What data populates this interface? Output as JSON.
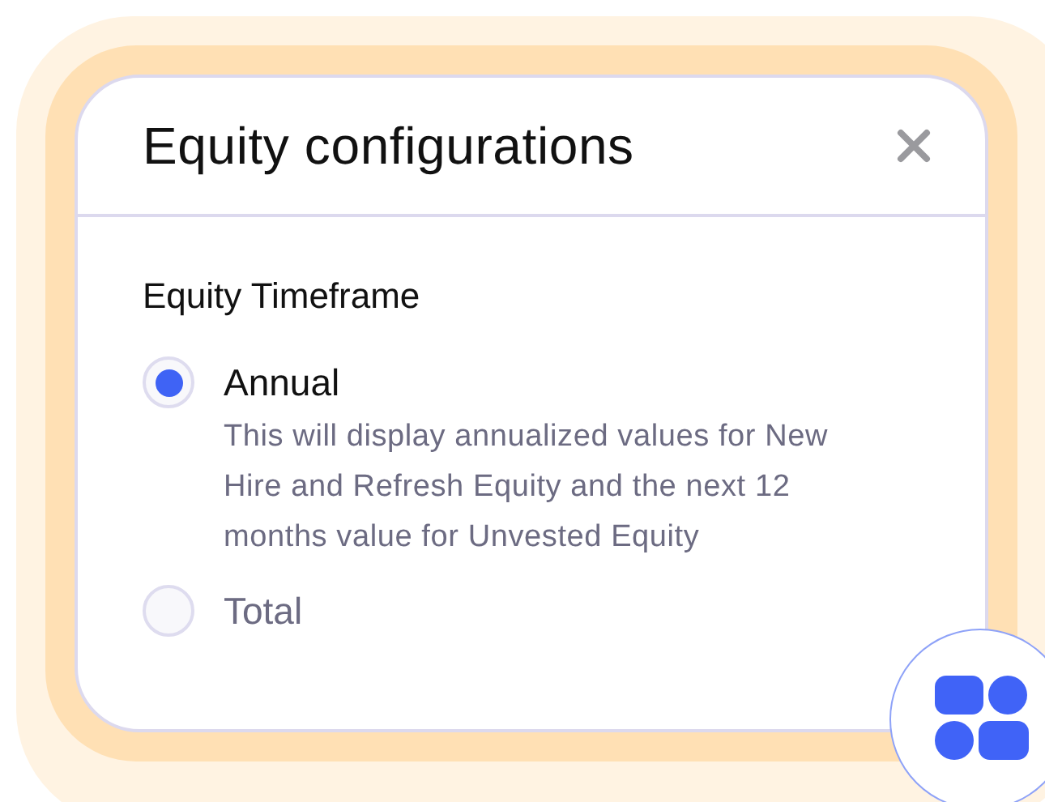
{
  "dialog": {
    "title": "Equity configurations",
    "section": {
      "heading": "Equity Timeframe",
      "options": [
        {
          "label": "Annual",
          "selected": true,
          "description": "This will display annualized values for New Hire and Refresh Equity and the next 12 months value for Unvested Equity"
        },
        {
          "label": "Total",
          "selected": false
        }
      ]
    }
  }
}
